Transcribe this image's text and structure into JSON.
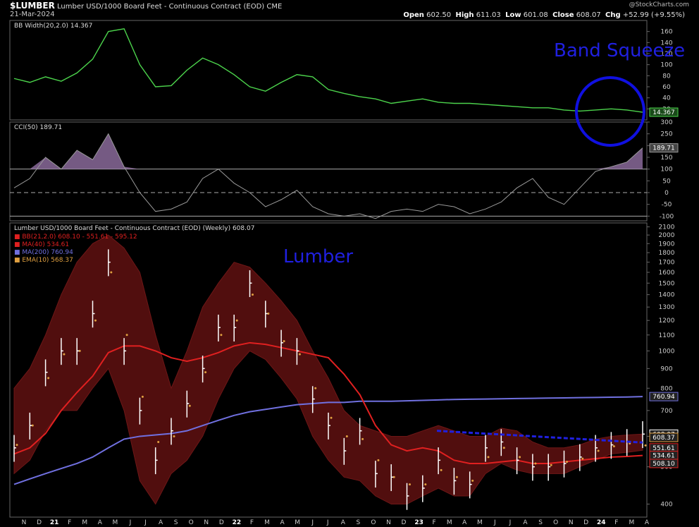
{
  "header": {
    "symbol": "$LUMBER",
    "description": "Lumber USD/1000 Board Feet - Continuous Contract (EOD)",
    "exchange": "CME",
    "date": "21-Mar-2024",
    "open_label": "Open",
    "open": "602.50",
    "high_label": "High",
    "high": "611.03",
    "low_label": "Low",
    "low": "601.08",
    "close_label": "Close",
    "close": "608.07",
    "chg_label": "Chg",
    "chg": "+52.99 (+9.55%)",
    "watermark": "@StockCharts.com"
  },
  "annotations": {
    "band_squeeze": "Band Squeeze",
    "lumber": "Lumber"
  },
  "colors": {
    "bbwidth": "#4cd44c",
    "cci_line": "#9a9a9a",
    "cci_fill": "#8a6a9a",
    "price": "#ffffff",
    "bb_fill": "#5a1010",
    "bb_edge": "#7a1a1a",
    "ma40": "#e02020",
    "ma200": "#7070e0",
    "ema10": "#e0a040",
    "trendline": "#2020e0",
    "circle": "#1010e0",
    "annotation": "#2020e0",
    "panel_border": "#666666"
  },
  "x_axis_labels": [
    "N",
    "D",
    "21",
    "F",
    "M",
    "A",
    "M",
    "J",
    "J",
    "A",
    "S",
    "O",
    "N",
    "D",
    "22",
    "F",
    "M",
    "A",
    "M",
    "J",
    "J",
    "A",
    "S",
    "O",
    "N",
    "D",
    "23",
    "F",
    "M",
    "A",
    "M",
    "J",
    "J",
    "A",
    "S",
    "O",
    "N",
    "D",
    "24",
    "F",
    "M",
    "A"
  ],
  "chart_data": [
    {
      "type": "line",
      "panel": "bbwidth",
      "legend": "BB Width(20,2.0) 14.367",
      "yticks": [
        20,
        40,
        60,
        80,
        100,
        120,
        140,
        160
      ],
      "ylim": [
        0,
        180
      ],
      "last_value_label": "14.367",
      "x": [
        "2020-11",
        "2020-12",
        "2021-01",
        "2021-02",
        "2021-03",
        "2021-04",
        "2021-05",
        "2021-06",
        "2021-07",
        "2021-08",
        "2021-09",
        "2021-10",
        "2021-11",
        "2021-12",
        "2022-01",
        "2022-02",
        "2022-03",
        "2022-04",
        "2022-05",
        "2022-06",
        "2022-07",
        "2022-08",
        "2022-09",
        "2022-10",
        "2022-11",
        "2022-12",
        "2023-01",
        "2023-02",
        "2023-03",
        "2023-04",
        "2023-05",
        "2023-06",
        "2023-07",
        "2023-08",
        "2023-09",
        "2023-10",
        "2023-11",
        "2023-12",
        "2024-01",
        "2024-02",
        "2024-03"
      ],
      "values": [
        75,
        68,
        78,
        70,
        85,
        110,
        160,
        165,
        100,
        60,
        62,
        90,
        112,
        100,
        82,
        60,
        52,
        68,
        82,
        78,
        55,
        48,
        42,
        38,
        30,
        34,
        38,
        32,
        30,
        30,
        28,
        26,
        24,
        22,
        22,
        18,
        16,
        18,
        20,
        18,
        14
      ]
    },
    {
      "type": "area",
      "panel": "cci",
      "legend": "CCI(50) 189.71",
      "yticks": [
        -100,
        -50,
        0,
        50,
        100,
        150,
        200,
        250,
        300
      ],
      "ylim": [
        -120,
        300
      ],
      "reference_lines": [
        -100,
        0,
        100
      ],
      "last_value_label": "189.71",
      "x": [
        "2020-11",
        "2020-12",
        "2021-01",
        "2021-02",
        "2021-03",
        "2021-04",
        "2021-05",
        "2021-06",
        "2021-07",
        "2021-08",
        "2021-09",
        "2021-10",
        "2021-11",
        "2021-12",
        "2022-01",
        "2022-02",
        "2022-03",
        "2022-04",
        "2022-05",
        "2022-06",
        "2022-07",
        "2022-08",
        "2022-09",
        "2022-10",
        "2022-11",
        "2022-12",
        "2023-01",
        "2023-02",
        "2023-03",
        "2023-04",
        "2023-05",
        "2023-06",
        "2023-07",
        "2023-08",
        "2023-09",
        "2023-10",
        "2023-11",
        "2023-12",
        "2024-01",
        "2024-02",
        "2024-03"
      ],
      "values": [
        20,
        60,
        150,
        100,
        180,
        140,
        250,
        110,
        0,
        -80,
        -70,
        -40,
        60,
        100,
        40,
        0,
        -60,
        -30,
        10,
        -60,
        -90,
        -100,
        -90,
        -110,
        -80,
        -70,
        -80,
        -50,
        -60,
        -90,
        -70,
        -40,
        20,
        60,
        -20,
        -50,
        20,
        90,
        110,
        130,
        190
      ]
    },
    {
      "type": "line",
      "panel": "price",
      "legend": "Lumber USD/1000 Board Feet - Continuous Contract (EOD) (Weekly) 608.07",
      "yscale": "log",
      "yticks": [
        400,
        500,
        600,
        700,
        800,
        900,
        1000,
        1100,
        1200,
        1300,
        1400,
        1500,
        1600,
        1700,
        1800,
        1900,
        2000,
        2100
      ],
      "ylim": [
        370,
        2150
      ],
      "series_legends": [
        {
          "label": "BB(21,2.0) 608.10 - 551.61 - 595.12",
          "color": "#e02020"
        },
        {
          "label": "MA(40) 534.61",
          "color": "#e02020"
        },
        {
          "label": "MA(200) 760.94",
          "color": "#7070e0"
        },
        {
          "label": "EMA(10) 568.37",
          "color": "#e0a040"
        }
      ],
      "value_tags": [
        {
          "label": "760.94",
          "value": 760.94,
          "color": "#7070e0"
        },
        {
          "label": "608.07",
          "value": 608.07,
          "color": "#ffffff"
        },
        {
          "label": "608.37",
          "value": 596,
          "color": "#e0a040"
        },
        {
          "label": "551.61",
          "value": 560,
          "color": "#e02020"
        },
        {
          "label": "534.61",
          "value": 535,
          "color": "#e02020"
        },
        {
          "label": "508.10",
          "value": 510,
          "color": "#e02020"
        }
      ],
      "x": [
        "2020-11",
        "2020-12",
        "2021-01",
        "2021-02",
        "2021-03",
        "2021-04",
        "2021-05",
        "2021-06",
        "2021-07",
        "2021-08",
        "2021-09",
        "2021-10",
        "2021-11",
        "2021-12",
        "2022-01",
        "2022-02",
        "2022-03",
        "2022-04",
        "2022-05",
        "2022-06",
        "2022-07",
        "2022-08",
        "2022-09",
        "2022-10",
        "2022-11",
        "2022-12",
        "2023-01",
        "2023-02",
        "2023-03",
        "2023-04",
        "2023-05",
        "2023-06",
        "2023-07",
        "2023-08",
        "2023-09",
        "2023-10",
        "2023-11",
        "2023-12",
        "2024-01",
        "2024-02",
        "2024-03"
      ],
      "series": [
        {
          "name": "Price",
          "values": [
            560,
            640,
            880,
            1000,
            1000,
            1250,
            1700,
            1000,
            700,
            520,
            620,
            730,
            900,
            1150,
            1150,
            1500,
            1250,
            1050,
            1000,
            750,
            640,
            550,
            620,
            480,
            470,
            420,
            440,
            520,
            460,
            450,
            560,
            580,
            520,
            500,
            500,
            510,
            530,
            560,
            570,
            580,
            608
          ]
        },
        {
          "name": "MA(40)",
          "values": [
            540,
            560,
            610,
            700,
            780,
            860,
            990,
            1030,
            1030,
            1000,
            960,
            940,
            960,
            990,
            1030,
            1050,
            1040,
            1020,
            1000,
            980,
            960,
            870,
            770,
            640,
            570,
            550,
            560,
            550,
            520,
            510,
            510,
            515,
            520,
            510,
            510,
            515,
            520,
            525,
            530,
            532,
            535
          ]
        },
        {
          "name": "MA(200)",
          "values": [
            450,
            465,
            480,
            495,
            510,
            530,
            560,
            590,
            600,
            605,
            610,
            620,
            640,
            660,
            680,
            695,
            705,
            715,
            725,
            730,
            735,
            735,
            740,
            740,
            740,
            742,
            744,
            746,
            748,
            749,
            750,
            751,
            752,
            753,
            754,
            755,
            756,
            757,
            758,
            759,
            761
          ]
        },
        {
          "name": "EMA(10)",
          "values": [
            570,
            640,
            850,
            980,
            1000,
            1200,
            1600,
            1100,
            760,
            580,
            600,
            720,
            880,
            1100,
            1200,
            1400,
            1250,
            1060,
            980,
            800,
            670,
            600,
            590,
            520,
            470,
            450,
            450,
            490,
            470,
            460,
            530,
            560,
            530,
            510,
            505,
            515,
            525,
            550,
            565,
            575,
            568
          ]
        },
        {
          "name": "BB Upper",
          "values": [
            800,
            900,
            1100,
            1400,
            1700,
            1900,
            2000,
            1850,
            1600,
            1100,
            800,
            1000,
            1300,
            1500,
            1700,
            1650,
            1500,
            1350,
            1200,
            1000,
            850,
            700,
            640,
            620,
            600,
            600,
            620,
            640,
            620,
            600,
            600,
            630,
            620,
            580,
            560,
            560,
            570,
            590,
            600,
            605,
            608
          ]
        },
        {
          "name": "BB Lower",
          "values": [
            480,
            520,
            620,
            700,
            700,
            800,
            900,
            700,
            460,
            400,
            480,
            520,
            600,
            750,
            900,
            1000,
            950,
            850,
            750,
            600,
            520,
            470,
            460,
            420,
            400,
            400,
            420,
            440,
            420,
            420,
            480,
            510,
            490,
            480,
            480,
            480,
            500,
            520,
            540,
            545,
            552
          ]
        }
      ]
    }
  ]
}
